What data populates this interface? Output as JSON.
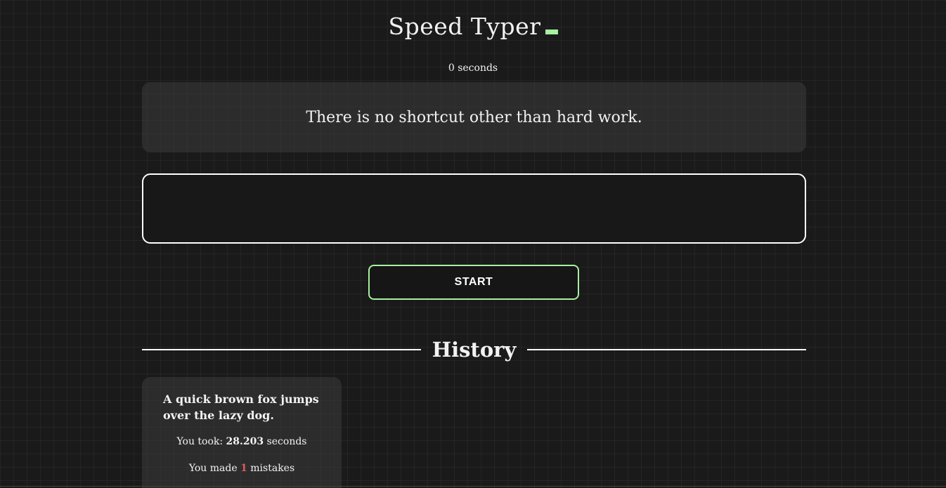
{
  "app": {
    "title": "Speed Typer"
  },
  "timer": {
    "label": "0 seconds"
  },
  "quote": {
    "text": "There is no shortcut other than hard work."
  },
  "typing_input": {
    "value": "",
    "placeholder": ""
  },
  "start_button": {
    "label": "START"
  },
  "history": {
    "heading": "History",
    "entries": [
      {
        "text": "A quick brown fox jumps over the lazy dog.",
        "took_prefix": "You took: ",
        "time": "28.203",
        "time_suffix": " seconds",
        "mistakes_prefix": "You made ",
        "mistakes": "1",
        "mistakes_suffix": " mistakes"
      }
    ]
  },
  "colors": {
    "accent": "#a6f0a0",
    "background": "#1a1a1a",
    "mistake": "#e05a5a"
  }
}
